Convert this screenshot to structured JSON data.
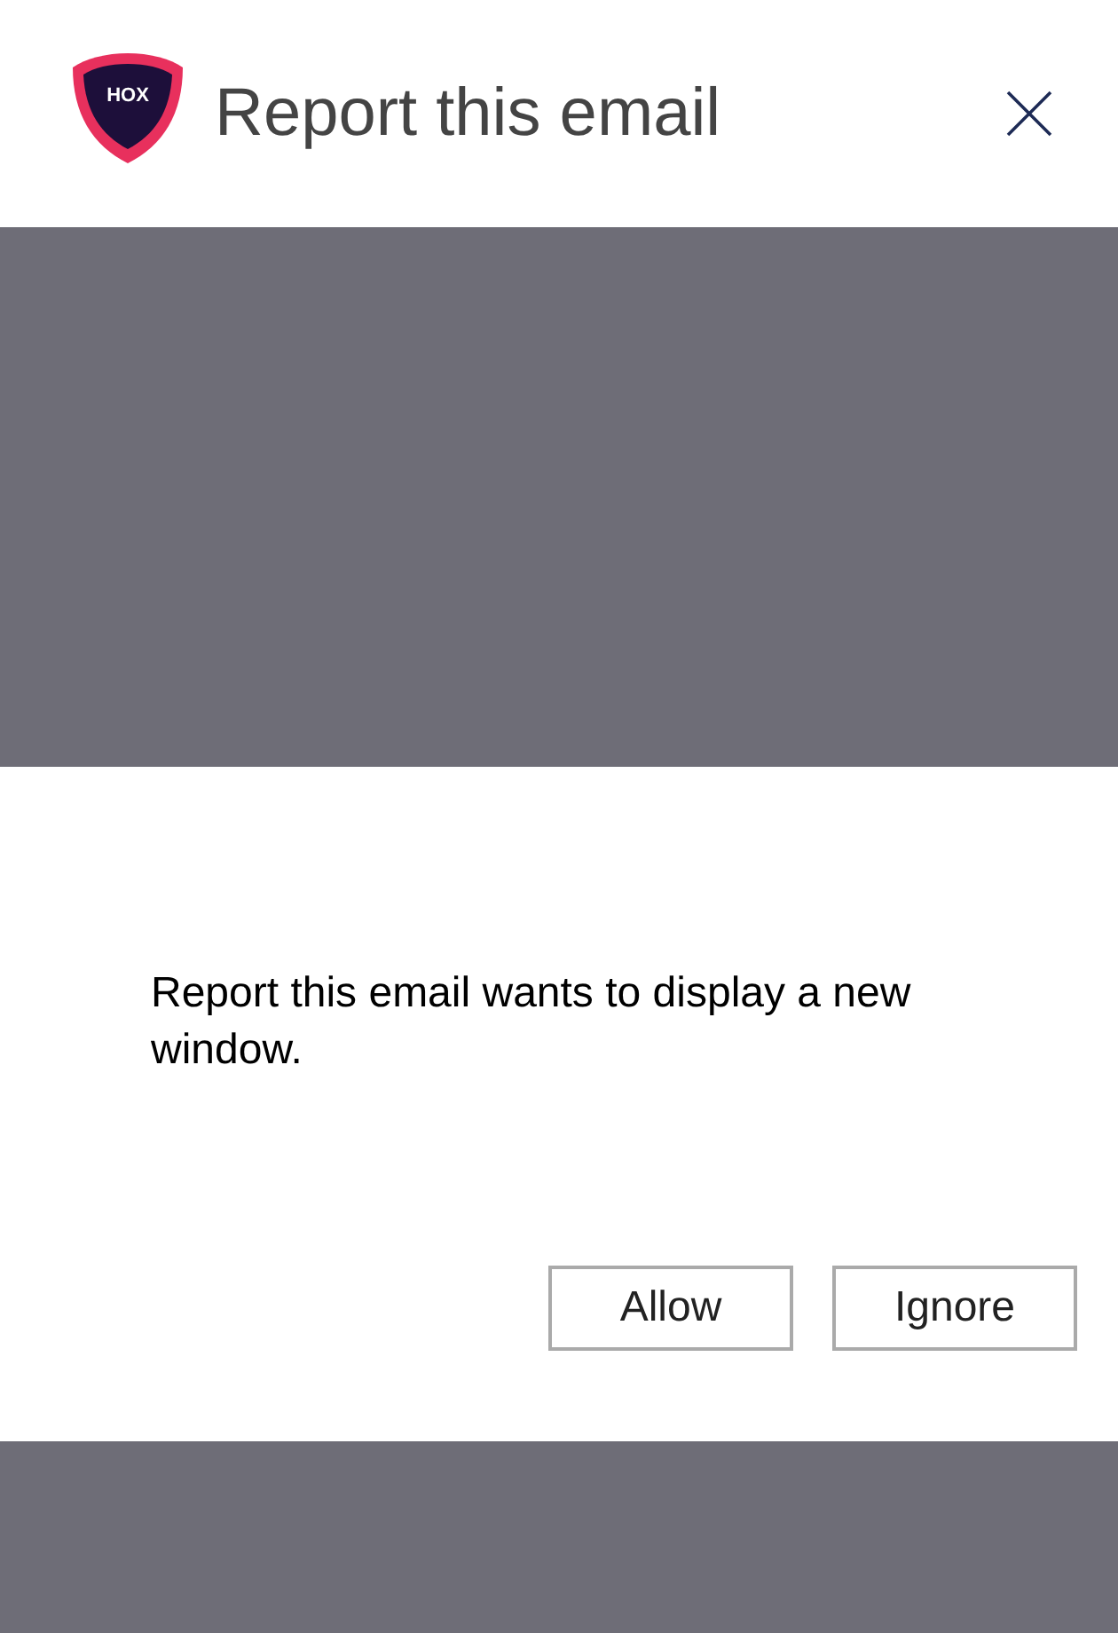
{
  "header": {
    "logo_text": "HOX",
    "title": "Report this email"
  },
  "dialog": {
    "message": "Report this email wants to display a new window.",
    "buttons": [
      "Allow",
      "Ignore"
    ]
  }
}
